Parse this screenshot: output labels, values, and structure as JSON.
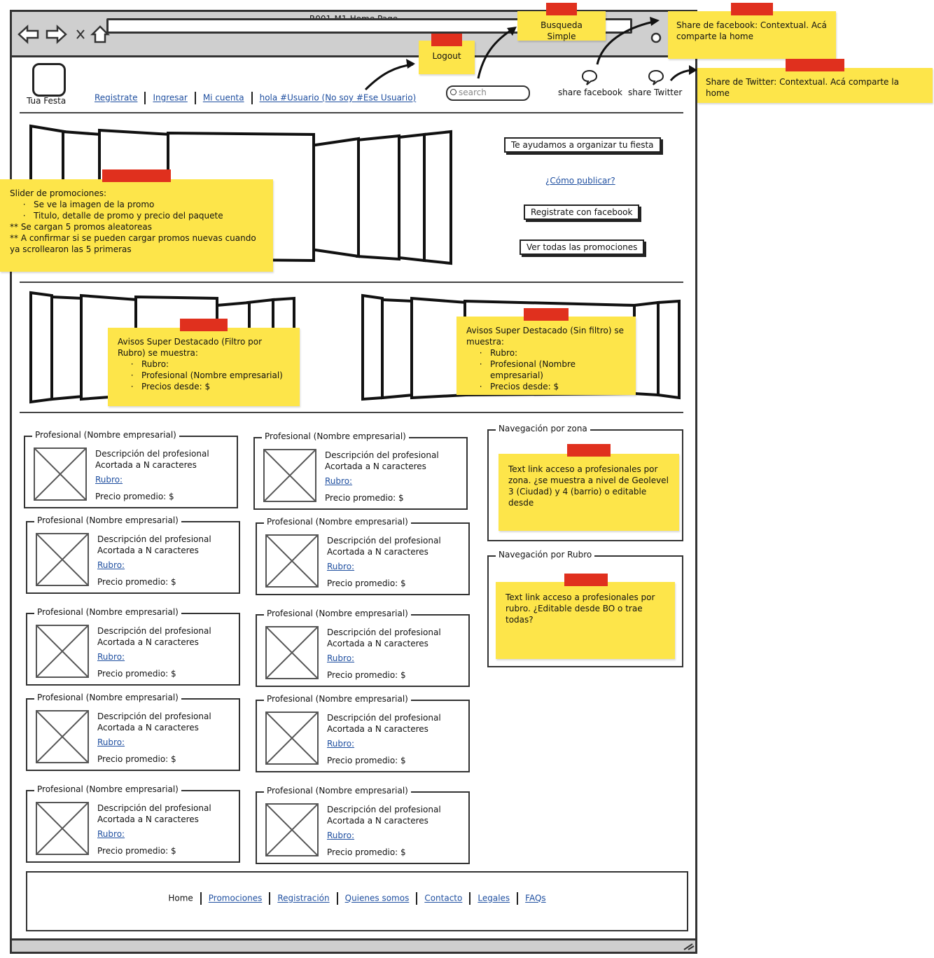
{
  "window": {
    "title": "R001-M1-Home Page"
  },
  "header": {
    "logo_label": "Tua Festa",
    "nav": [
      "Registrate",
      "Ingresar",
      "Mi cuenta",
      "hola #Usuario (No soy #Ese Usuario)"
    ],
    "search_placeholder": "search",
    "share_facebook": "share facebook",
    "share_twitter": "share Twitter"
  },
  "hero": {
    "btn_organizar": "Te ayudamos a organizar tu fiesta",
    "link_publicar": "¿Cómo publicar?",
    "btn_facebook": "Registrate con facebook",
    "btn_promos": "Ver todas las promociones"
  },
  "notes": {
    "logout": "Logout",
    "busqueda": "Busqueda Simple",
    "facebook": "Share de facebook: Contextual. Acá comparte la home",
    "twitter": "Share de Twitter: Contextual. Acá comparte la home",
    "slider_title": "Slider de promociones:",
    "slider_items": [
      "Se ve la imagen de la promo",
      "Titulo, detalle de promo y precio del paquete"
    ],
    "slider_extra1": "** Se cargan 5 promos aleatoreas",
    "slider_extra2": "** A confirmar si se pueden cargar promos nuevas cuando ya scrollearon las 5 primeras",
    "destacado1_title": "Avisos Super Destacado (Filtro por Rubro) se muestra:",
    "destacado2_title": "Avisos Super Destacado (Sin filtro) se muestra:",
    "destacado_items": [
      "Rubro:",
      "Profesional (Nombre empresarial)",
      "Precios desde: $"
    ],
    "zona": "Text link acceso a profesionales por zona. ¿se muestra a nivel de Geolevel 3 (Ciudad) y 4 (barrio) o editable desde",
    "rubro": "Text link acceso a profesionales por rubro. ¿Editable desde BO o trae todas?"
  },
  "card": {
    "title": "Profesional (Nombre empresarial)",
    "desc1": "Descripción del profesional",
    "desc2": "Acortada a N caracteres",
    "rubro": "Rubro:",
    "precio": "Precio promedio: $"
  },
  "side": {
    "zona_title": "Navegación por zona",
    "rubro_title": "Navegación por Rubro"
  },
  "footer": {
    "links": [
      "Home",
      "Promociones",
      "Registración",
      "Quienes somos",
      "Contacto",
      "Legales",
      "FAQs"
    ]
  },
  "colors": {
    "sticky": "#fde54a",
    "tape": "#e0301e",
    "link": "#1f4fa0"
  }
}
